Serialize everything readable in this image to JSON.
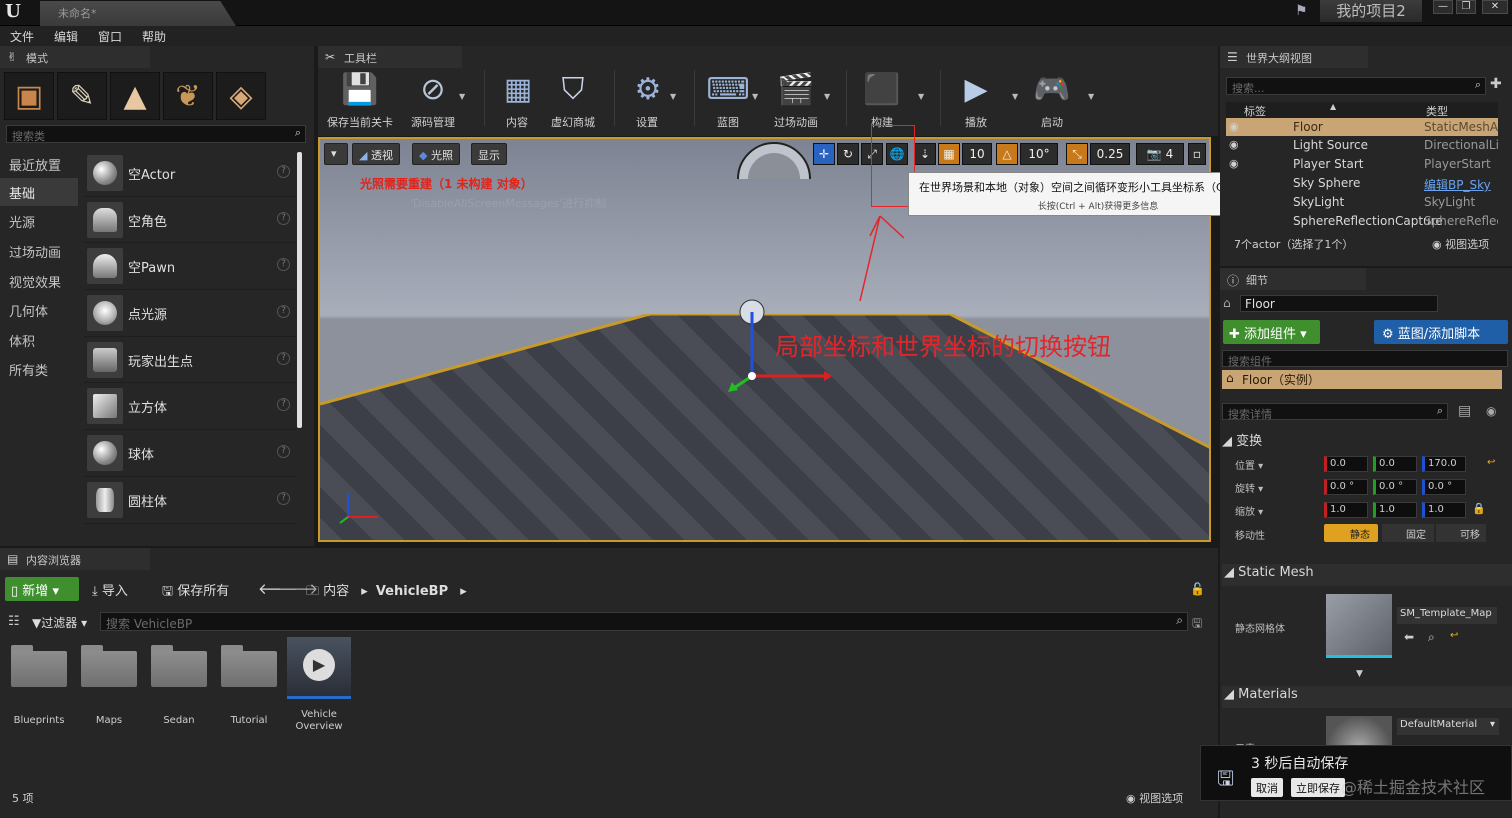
{
  "title_bar": {
    "doc_tab": "未命名*",
    "project": "我的项目2",
    "min": "—",
    "max": "❐",
    "close": "✕"
  },
  "menu": [
    "文件",
    "编辑",
    "窗口",
    "帮助"
  ],
  "modes": {
    "tab": "模式",
    "search_placeholder": "搜索类",
    "categories": [
      "最近放置",
      "基础",
      "光源",
      "过场动画",
      "视觉效果",
      "几何体",
      "体积",
      "所有类"
    ],
    "items": [
      "空Actor",
      "空角色",
      "空Pawn",
      "点光源",
      "玩家出生点",
      "立方体",
      "球体",
      "圆柱体"
    ]
  },
  "toolbar": {
    "tab": "工具栏",
    "buttons": [
      "保存当前关卡",
      "源码管理",
      "内容",
      "虚幻商城",
      "设置",
      "蓝图",
      "过场动画",
      "构建",
      "播放",
      "启动"
    ]
  },
  "viewport": {
    "perspective": "透视",
    "lit": "光照",
    "show": "显示",
    "grid": "10",
    "angle": "10°",
    "scale": "0.25",
    "camera_speed": "4",
    "warning": "光照需要重建（1 未构建 对象）",
    "suppress": "'DisableAllScreenMessages'进行抑制",
    "annotation": "局部坐标和世界坐标的切换按钮",
    "tooltip_main": "在世界场景和本地（对象）空间之间循环变形小工具坐标系（Ctrl+`）",
    "tooltip_sub": "长按(Ctrl + Alt)获得更多信息"
  },
  "outliner": {
    "tab": "世界大纲视图",
    "search_placeholder": "搜索...",
    "col_label": "标签",
    "col_type": "类型",
    "rows": [
      {
        "name": "Floor",
        "type": "StaticMeshActor"
      },
      {
        "name": "Light Source",
        "type": "DirectionalLight"
      },
      {
        "name": "Player Start",
        "type": "PlayerStart"
      },
      {
        "name": "Sky Sphere",
        "type": "编辑BP_Sky"
      },
      {
        "name": "SkyLight",
        "type": "SkyLight"
      },
      {
        "name": "SphereReflectionCapture",
        "type": "SphereReflectionCapture"
      }
    ],
    "footer": "7个actor（选择了1个）",
    "view_options": "视图选项"
  },
  "details": {
    "tab": "细节",
    "name": "Floor",
    "add_component": "添加组件",
    "blueprint": "蓝图/添加脚本",
    "search_components": "搜索组件",
    "instance": "Floor（实例）",
    "search_details": "搜索详情",
    "transform": "变换",
    "location_lbl": "位置",
    "rotation_lbl": "旋转",
    "scale_lbl": "缩放",
    "mobility_lbl": "移动性",
    "location": [
      "0.0",
      "0.0",
      "170.0"
    ],
    "rotation": [
      "0.0 °",
      "0.0 °",
      "0.0 °"
    ],
    "scale": [
      "1.0",
      "1.0",
      "1.0"
    ],
    "mobility": [
      "静态",
      "固定",
      "可移"
    ],
    "static_mesh_section": "Static Mesh",
    "static_mesh_lbl": "静态网格体",
    "static_mesh_value": "SM_Template_Map",
    "materials_section": "Materials",
    "element_lbl": "元素 0",
    "material_value": "DefaultMaterial"
  },
  "content_browser": {
    "tab": "内容浏览器",
    "new": "新增",
    "import": "导入",
    "save_all": "保存所有",
    "path_root": "内容",
    "path_current": "VehicleBP",
    "filter": "过滤器",
    "search_placeholder": "搜索 VehicleBP",
    "folders": [
      "Blueprints",
      "Maps",
      "Sedan",
      "Tutorial"
    ],
    "asset": "Vehicle Overview",
    "count": "5 项",
    "view_options": "视图选项"
  },
  "toast": {
    "text": "3 秒后自动保存",
    "cancel": "取消",
    "save_now": "立即保存"
  },
  "watermark": "@稀土掘金技术社区",
  "colors": {
    "accent_orange": "#c89a2a",
    "annotation_red": "#e3262a",
    "green": "#3f8f2e",
    "blue": "#1f5fa8"
  }
}
